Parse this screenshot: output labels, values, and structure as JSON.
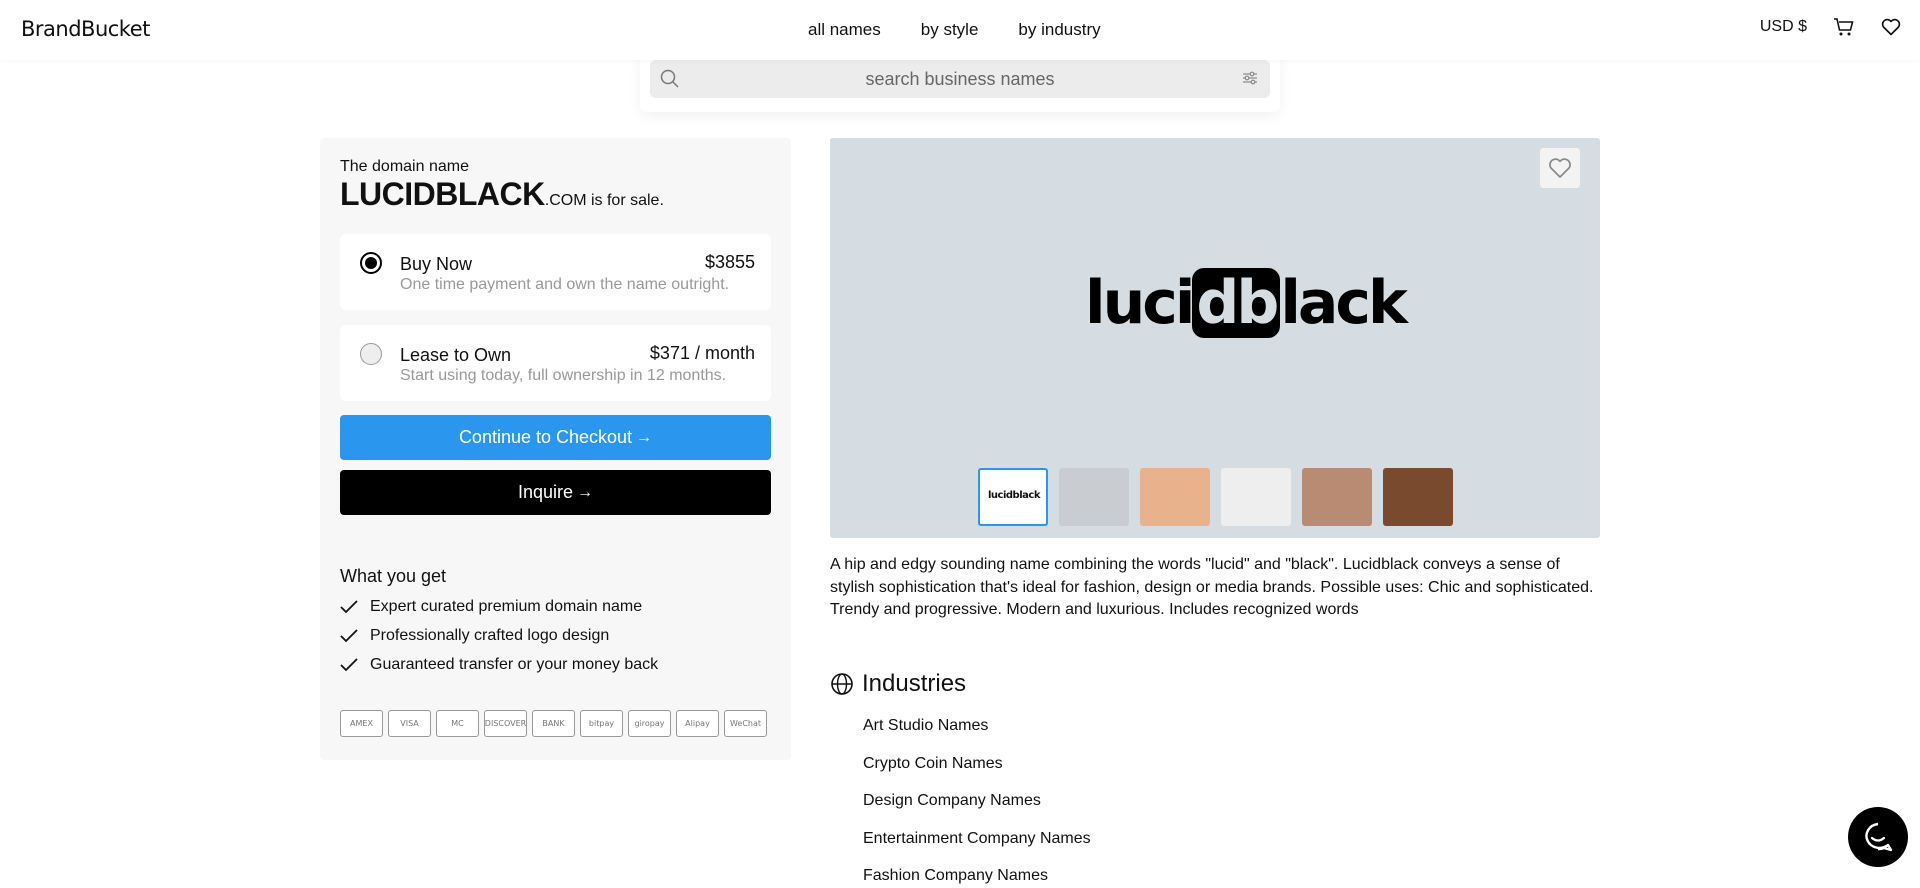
{
  "header": {
    "logo": "BrandBucket",
    "nav": [
      "all names",
      "by style",
      "by industry"
    ],
    "currency": "USD $ ",
    "icons": [
      "cart-icon",
      "heart-icon"
    ]
  },
  "search": {
    "placeholder": "search business names",
    "icons": [
      "search-icon",
      "filter-icon"
    ]
  },
  "listing": {
    "label": "The domain name",
    "name": "LUCIDBLACK",
    "tld": ".COM",
    "sale_text": " is for sale.",
    "options": [
      {
        "title": "Buy Now",
        "price": "$3855",
        "subtitle": "One time payment and own the name outright.",
        "selected": true
      },
      {
        "title": "Lease to Own",
        "price": "$371 / month",
        "subtitle": "Start using today, full ownership in 12 months.",
        "selected": false
      }
    ],
    "checkout_label": "Continue to Checkout",
    "inquire_label": "Inquire",
    "arrow": "→"
  },
  "what_you_get": {
    "title": "What you get",
    "items": [
      "Expert curated premium domain name",
      "Professionally crafted logo design",
      "Guaranteed transfer or your money back"
    ]
  },
  "payments": [
    "AMEX",
    "VISA",
    "MC",
    "DISCOVER",
    "BANK",
    "bitpay",
    "giropay",
    "Alipay",
    "WeChat"
  ],
  "preview": {
    "logo_parts": [
      "luci",
      "db",
      "lack"
    ],
    "thumb_logo": "lucidblack",
    "thumb_colors": [
      "#ffffff",
      "#c9ccd0",
      "#e8b38c",
      "#eeeeee",
      "#b98b72",
      "#7a4a2e"
    ]
  },
  "description": "A hip and edgy sounding name combining the words \"lucid\" and \"black\". Lucidblack conveys a sense of stylish sophistication that's ideal for fashion, design or media brands. Possible uses: Chic and sophisticated. Trendy and progressive. Modern and luxurious. Includes recognized words",
  "industries": {
    "title": "Industries",
    "items": [
      "Art Studio Names",
      "Crypto Coin Names",
      "Design Company Names",
      "Entertainment Company Names",
      "Fashion Company Names"
    ]
  },
  "colors": {
    "accent": "#2b96ee",
    "preview_bg": "#d5dde2",
    "panel_bg": "#f7f7f7"
  }
}
